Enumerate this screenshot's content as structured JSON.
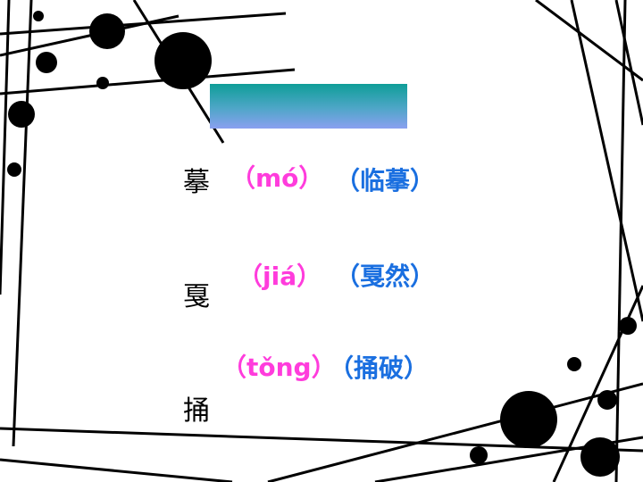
{
  "colors": {
    "pinyin": "#ff3cdc",
    "word": "#1a6fe0",
    "char": "#000000",
    "decor": "#000000",
    "title_bar_top": "#0f9e98",
    "title_bar_bottom": "#8aa0f0"
  },
  "items": [
    {
      "char": "摹",
      "pinyin": "（mó）",
      "word": "（临摹）"
    },
    {
      "char": "戛",
      "pinyin": "（jiá）",
      "word": "（戛然）"
    },
    {
      "char": "捅",
      "pinyin": "（tǒng）",
      "word": "（捅破）"
    }
  ]
}
